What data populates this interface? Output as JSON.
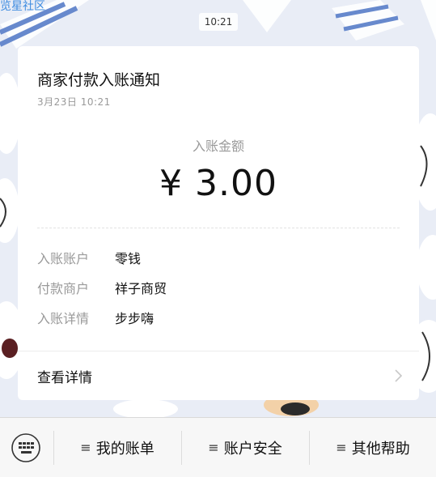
{
  "watermark": "览星社区",
  "chat_time": "10:21",
  "card": {
    "title": "商家付款入账通知",
    "date": "3月23日  10:21",
    "amount_label": "入账金额",
    "amount_value": "¥ 3.00",
    "rows": [
      {
        "key": "入账账户",
        "value": "零钱"
      },
      {
        "key": "付款商户",
        "value": "祥子商贸"
      },
      {
        "key": "入账详情",
        "value": "步步嗨"
      }
    ],
    "detail_link": "查看详情"
  },
  "bottom_menu": {
    "keyboard_icon": "keyboard-icon",
    "items": [
      {
        "label": "我的账单",
        "icon": "menu-lines-icon"
      },
      {
        "label": "账户安全",
        "icon": "menu-lines-icon"
      },
      {
        "label": "其他帮助",
        "icon": "menu-lines-icon"
      }
    ]
  },
  "colors": {
    "card_bg": "#ffffff",
    "muted_text": "#9a9a9a",
    "wallpaper_bg": "#e9edf6",
    "watermark": "#3d8be0"
  }
}
